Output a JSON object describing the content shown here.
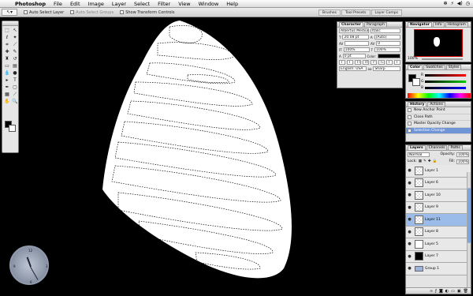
{
  "menubar": {
    "app_name": "Photoshop",
    "items": [
      "File",
      "Edit",
      "Image",
      "Layer",
      "Select",
      "Filter",
      "View",
      "Window",
      "Help"
    ],
    "status_icons": [
      "✻",
      "⚡",
      "◀)",
      "◷"
    ]
  },
  "options_bar": {
    "tool_icon": "arrow",
    "auto_select_layer": "Auto Select Layer",
    "auto_select_groups": "Auto Select Groups",
    "show_transform": "Show Transform Controls",
    "wells": [
      "Brushes",
      "Tool Presets",
      "Layer Comps"
    ]
  },
  "character": {
    "tabs": [
      "Character",
      "Paragraph"
    ],
    "font_family": "Albertus Medium",
    "font_style": "Italic",
    "font_size": "20.08 pt",
    "leading": "(Auto)",
    "tracking": "0",
    "scale_v": "100%",
    "scale_h": "100%",
    "baseline": "0 pt",
    "color_label": "Color:",
    "language": "English: USA",
    "antialias": "Sharp"
  },
  "navigator": {
    "tabs": [
      "Navigator",
      "Info",
      "Histogram"
    ],
    "zoom": "100%"
  },
  "color_panel": {
    "tabs": [
      "Color",
      "Swatches",
      "Styles"
    ],
    "channels": [
      "R",
      "G",
      "B"
    ]
  },
  "history": {
    "tabs": [
      "History",
      "Actions"
    ],
    "items": [
      {
        "label": "New Anchor Point",
        "selected": false
      },
      {
        "label": "Close Path",
        "selected": false
      },
      {
        "label": "Master Opacity Change",
        "selected": false
      },
      {
        "label": "Selection Change",
        "selected": true
      }
    ]
  },
  "layers": {
    "tabs": [
      "Layers",
      "Channels",
      "Paths"
    ],
    "blend_mode": "Normal",
    "opacity_label": "Opacity:",
    "opacity": "100%",
    "lock_label": "Lock:",
    "fill_label": "Fill:",
    "fill": "100%",
    "rows": [
      {
        "name": "Layer 1",
        "thumb": "img",
        "selected": false
      },
      {
        "name": "Layer 6",
        "thumb": "trans",
        "selected": false
      },
      {
        "name": "Layer 10",
        "thumb": "trans",
        "selected": false
      },
      {
        "name": "Layer 9",
        "thumb": "trans",
        "selected": false
      },
      {
        "name": "Layer 11",
        "thumb": "trans",
        "selected": true
      },
      {
        "name": "Layer 8",
        "thumb": "trans",
        "selected": false
      },
      {
        "name": "Layer 5",
        "thumb": "shape",
        "selected": false
      },
      {
        "name": "Layer 7",
        "thumb": "black",
        "selected": false
      },
      {
        "name": "Group 1",
        "thumb": "folder",
        "selected": false
      }
    ]
  }
}
